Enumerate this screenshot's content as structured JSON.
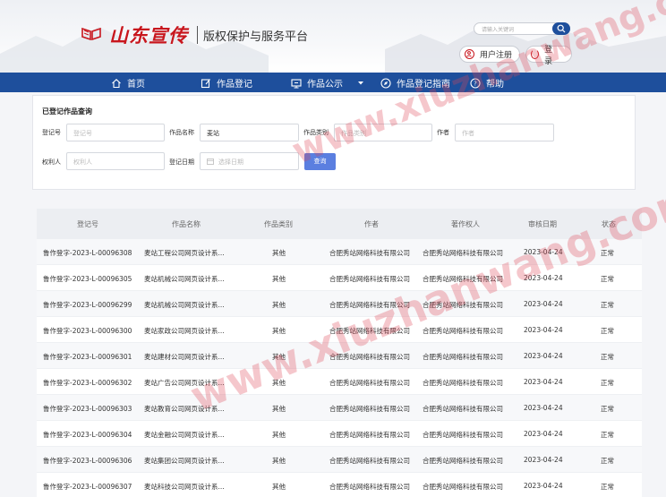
{
  "header": {
    "logo_script": "山东宣传",
    "platform_name": "版权保护与服务平台",
    "search_placeholder": "请输入关键词",
    "register_label": "用户注册",
    "login_label": "登录"
  },
  "nav": [
    {
      "label": "首页",
      "icon": "home-icon"
    },
    {
      "label": "作品登记",
      "icon": "edit-icon"
    },
    {
      "label": "作品公示",
      "icon": "monitor-icon"
    },
    {
      "label": "作品登记指南",
      "icon": "compass-icon"
    },
    {
      "label": "帮助",
      "icon": "help-icon"
    }
  ],
  "query": {
    "title": "已登记作品查询",
    "reg_no_label": "登记号",
    "reg_no_placeholder": "登记号",
    "work_name_label": "作品名称",
    "work_name_value": "麦站",
    "category_label": "作品类别",
    "category_placeholder": "作品类别",
    "author_label": "作者",
    "author_placeholder": "作者",
    "owner_label": "权利人",
    "owner_placeholder": "权利人",
    "date_label": "登记日期",
    "date_placeholder": "选择日期",
    "submit_label": "查询"
  },
  "table": {
    "headers": [
      "登记号",
      "作品名称",
      "作品类别",
      "作者",
      "著作权人",
      "审核日期",
      "状态"
    ],
    "rows": [
      [
        "鲁作登字-2023-L-00096308",
        "麦站工程公司网页设计系...",
        "其他",
        "合肥秀站网络科技有限公司",
        "合肥秀站网络科技有限公司",
        "2023-04-24",
        "正常"
      ],
      [
        "鲁作登字-2023-L-00096305",
        "麦站机械公司网页设计系...",
        "其他",
        "合肥秀站网络科技有限公司",
        "合肥秀站网络科技有限公司",
        "2023-04-24",
        "正常"
      ],
      [
        "鲁作登字-2023-L-00096299",
        "麦站机械公司网页设计系...",
        "其他",
        "合肥秀站网络科技有限公司",
        "合肥秀站网络科技有限公司",
        "2023-04-24",
        "正常"
      ],
      [
        "鲁作登字-2023-L-00096300",
        "麦站家政公司网页设计系...",
        "其他",
        "合肥秀站网络科技有限公司",
        "合肥秀站网络科技有限公司",
        "2023-04-24",
        "正常"
      ],
      [
        "鲁作登字-2023-L-00096301",
        "麦站建材公司网页设计系...",
        "其他",
        "合肥秀站网络科技有限公司",
        "合肥秀站网络科技有限公司",
        "2023-04-24",
        "正常"
      ],
      [
        "鲁作登字-2023-L-00096302",
        "麦站广告公司网页设计系...",
        "其他",
        "合肥秀站网络科技有限公司",
        "合肥秀站网络科技有限公司",
        "2023-04-24",
        "正常"
      ],
      [
        "鲁作登字-2023-L-00096303",
        "麦站教育公司网页设计系...",
        "其他",
        "合肥秀站网络科技有限公司",
        "合肥秀站网络科技有限公司",
        "2023-04-24",
        "正常"
      ],
      [
        "鲁作登字-2023-L-00096304",
        "麦站金融公司网页设计系...",
        "其他",
        "合肥秀站网络科技有限公司",
        "合肥秀站网络科技有限公司",
        "2023-04-24",
        "正常"
      ],
      [
        "鲁作登字-2023-L-00096306",
        "麦站集团公司网页设计系...",
        "其他",
        "合肥秀站网络科技有限公司",
        "合肥秀站网络科技有限公司",
        "2023-04-24",
        "正常"
      ],
      [
        "鲁作登字-2023-L-00096307",
        "麦站科技公司网页设计系...",
        "其他",
        "合肥秀站网络科技有限公司",
        "合肥秀站网络科技有限公司",
        "2023-04-24",
        "正常"
      ]
    ]
  },
  "watermark": "www.xiuzhanwang.com",
  "colors": {
    "brand_red": "#c8161d",
    "nav_blue": "#1e4f9c",
    "button_blue": "#5b7fe0"
  }
}
